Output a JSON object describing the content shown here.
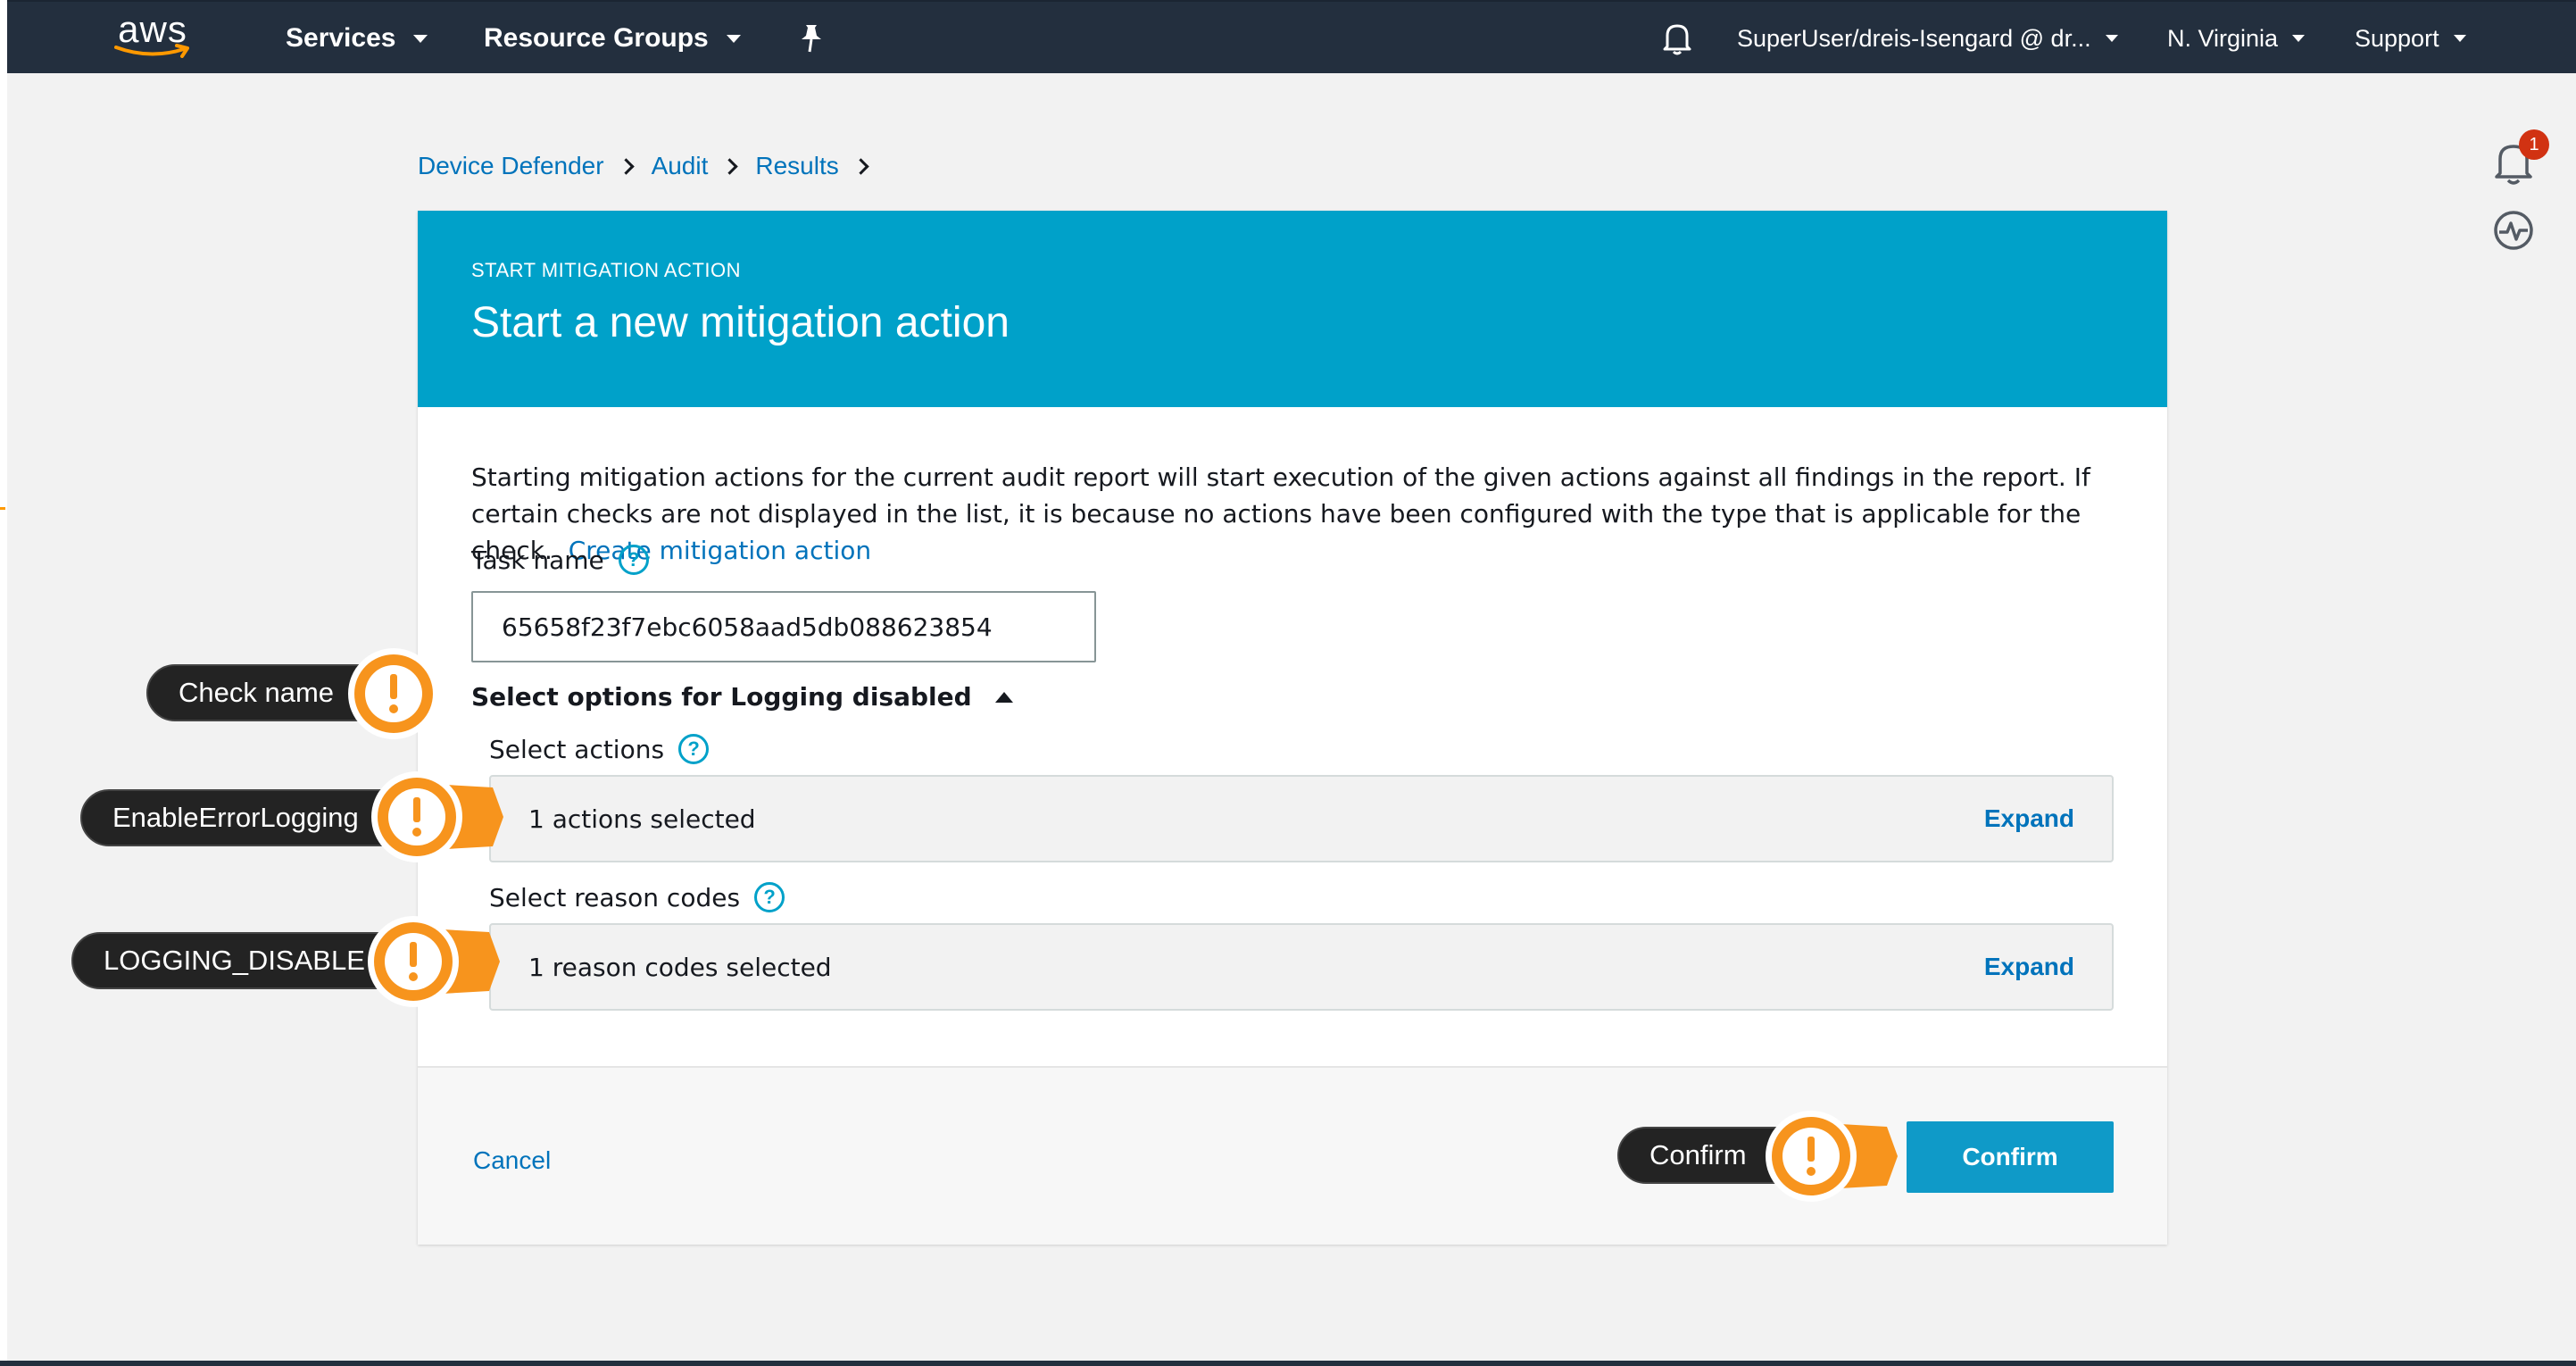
{
  "nav": {
    "logo": "aws",
    "services": "Services",
    "resource_groups": "Resource Groups",
    "pin_icon": "pin-icon",
    "bell_icon": "bell-icon",
    "account": "SuperUser/dreis-Isengard @ dr...",
    "region": "N. Virginia",
    "support": "Support"
  },
  "rail": {
    "notifications_count": "1",
    "notifications_icon": "bell-icon",
    "health_icon": "activity-icon"
  },
  "breadcrumb": [
    "Device Defender",
    "Audit",
    "Results"
  ],
  "card": {
    "eyebrow": "START MITIGATION ACTION",
    "title": "Start a new mitigation action",
    "description": "Starting mitigation actions for the current audit report will start execution of the given actions against all findings in the report. If certain checks are not displayed in the list, it is because no actions have been configured with the type that is applicable for the check.",
    "create_link": "Create mitigation action",
    "task_name_label": "Task name",
    "task_name_value": "65658f23f7ebc6058aad5db088623854",
    "section_toggle": "Select options for Logging disabled",
    "select_actions_label": "Select actions",
    "actions_summary": "1 actions selected",
    "reason_codes_label": "Select reason codes",
    "reason_codes_summary": "1 reason codes selected",
    "expand_label": "Expand",
    "cancel": "Cancel",
    "confirm": "Confirm"
  },
  "callouts": {
    "check_name": "Check name",
    "enable_error_logging": "EnableErrorLogging",
    "logging_disable": "LOGGING_DISABLE",
    "confirm": "Confirm",
    "marker_icon": "exclamation-icon"
  },
  "colors": {
    "nav_bg": "#232f3e",
    "header_bg": "#00a1c9",
    "link": "#0073bb",
    "callout_orange": "#f7941d",
    "badge": "#d13212"
  }
}
